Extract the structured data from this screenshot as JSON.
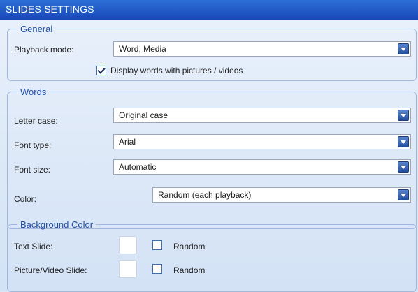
{
  "title": "SLIDES SETTINGS",
  "general": {
    "legend": "General",
    "playback_mode_label": "Playback mode:",
    "playback_mode_value": "Word, Media",
    "display_words_label": "Display words with pictures / videos",
    "display_words_checked": true
  },
  "words": {
    "legend": "Words",
    "letter_case_label": "Letter case:",
    "letter_case_value": "Original case",
    "font_type_label": "Font type:",
    "font_type_value": "Arial",
    "font_size_label": "Font size:",
    "font_size_value": "Automatic",
    "color_label": "Color:",
    "color_value": "Random (each playback)"
  },
  "background": {
    "legend": "Background Color",
    "text_slide_label": "Text Slide:",
    "text_slide_random_label": "Random",
    "text_slide_random_checked": false,
    "picture_slide_label": "Picture/Video Slide:",
    "picture_slide_random_label": "Random",
    "picture_slide_random_checked": false
  },
  "colors": {
    "title_bar": "#1f56c4",
    "group_label": "#1e4fa8",
    "panel": "#dde8f7"
  }
}
